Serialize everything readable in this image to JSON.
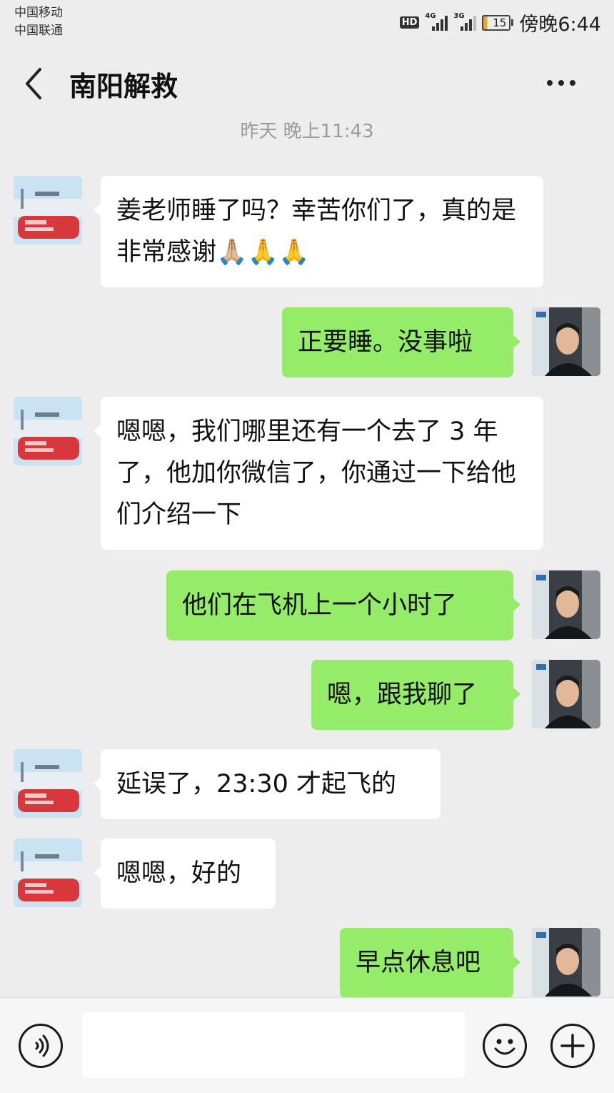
{
  "status_bar": {
    "carrier_1": "中国移动",
    "carrier_2": "中国联通",
    "hd_label": "HD",
    "network_1": "4G",
    "network_2": "3G",
    "battery_level": "15",
    "time": "傍晚6:44"
  },
  "header": {
    "back_icon": "chevron-left-icon",
    "title": "南阳解救",
    "more_icon": "more-dots-icon"
  },
  "timestamp": "昨天 晚上11:43",
  "messages": [
    {
      "direction": "in",
      "text": "姜老师睡了吗？幸苦你们了，真的是非常感谢🙏🏼🙏🙏"
    },
    {
      "direction": "out",
      "text": "正要睡。没事啦"
    },
    {
      "direction": "in",
      "text": "嗯嗯，我们哪里还有一个去了 3 年了，他加你微信了，你通过一下给他们介绍一下"
    },
    {
      "direction": "out",
      "text": "他们在飞机上一个小时了"
    },
    {
      "direction": "out",
      "text": "嗯，跟我聊了"
    },
    {
      "direction": "in",
      "text": "延误了，23:30 才起飞的"
    },
    {
      "direction": "in",
      "text": "嗯嗯，好的"
    },
    {
      "direction": "out",
      "text": "早点休息吧"
    }
  ],
  "input_bar": {
    "voice_icon": "voice-icon",
    "input_value": "",
    "emoji_icon": "emoji-icon",
    "plus_icon": "plus-icon"
  },
  "colors": {
    "background": "#ededed",
    "incoming_bubble": "#ffffff",
    "outgoing_bubble": "#95ec69"
  }
}
